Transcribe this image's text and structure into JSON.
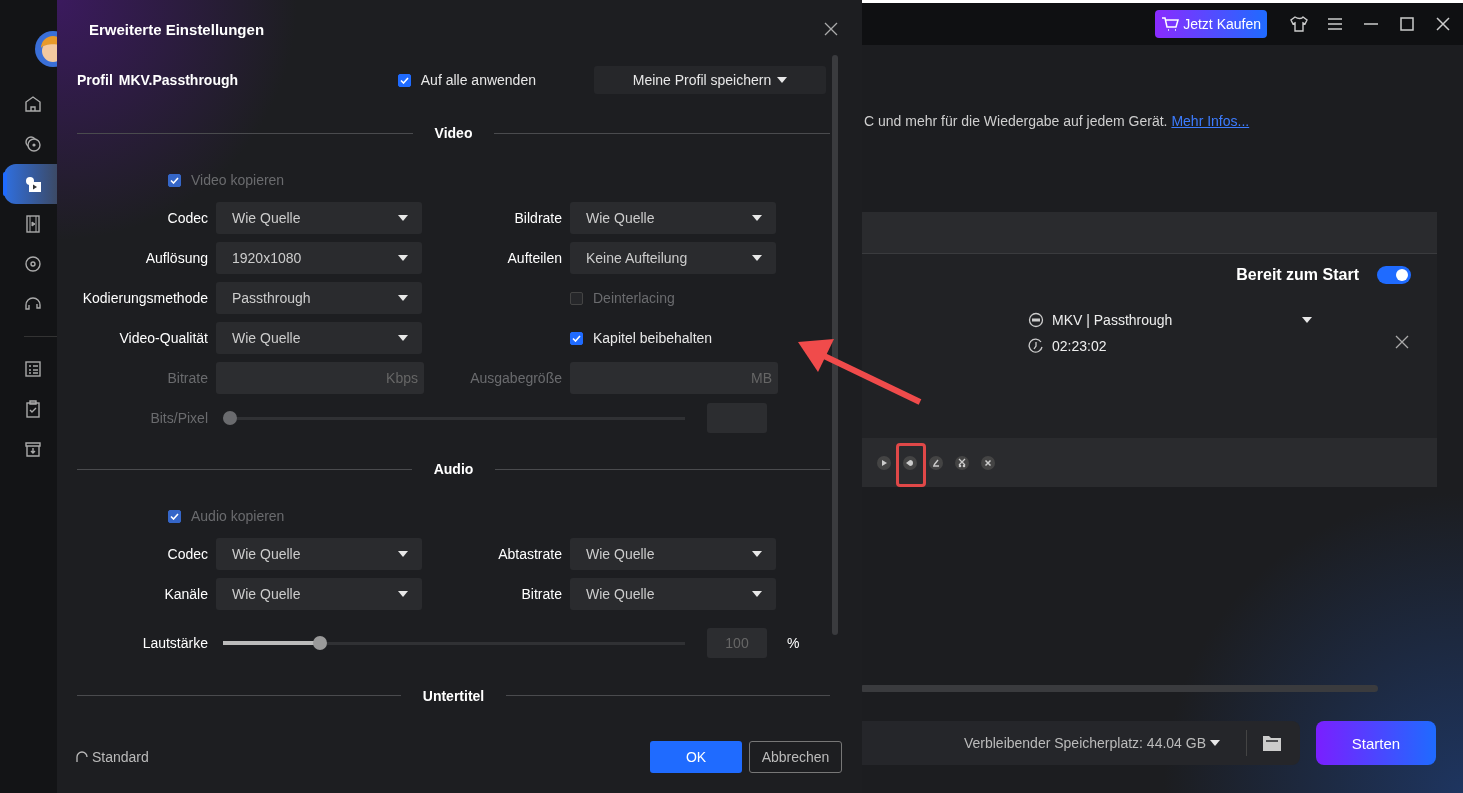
{
  "window": {
    "buy_button": "Jetzt Kaufen"
  },
  "sidebar": {
    "items": [
      {
        "selected": false
      },
      {
        "selected": false
      },
      {
        "selected": true
      },
      {
        "selected": false
      },
      {
        "selected": false
      },
      {
        "selected": false
      },
      {
        "selected": false
      },
      {
        "selected": false
      },
      {
        "selected": false
      }
    ]
  },
  "intro": {
    "text": "C und mehr für die Wiedergabe auf jedem Gerät.",
    "link": "Mehr Infos..."
  },
  "task": {
    "ready_label": "Bereit zum Start",
    "ready_on": true,
    "format": "MKV | Passthrough",
    "duration": "02:23:02"
  },
  "bottom_bar": {
    "storage": "Verbleibender Speicherplatz: 44.04 GB",
    "start_button": "Starten"
  },
  "dialog": {
    "title": "Erweiterte Einstellungen",
    "profile_label": "Profil",
    "profile_name": "MKV.Passthrough",
    "apply_all": {
      "label": "Auf alle anwenden",
      "checked": true
    },
    "save_profile": "Meine Profil speichern",
    "sections": [
      {
        "title": "Video",
        "rows": [
          {
            "kind": "copy",
            "label": "Video kopieren",
            "checked": true,
            "disabled": true
          },
          {
            "kind": "fields",
            "fields": [
              {
                "kind": "select",
                "label": "Codec",
                "value": "Wie Quelle"
              },
              {
                "kind": "select",
                "label": "Bildrate",
                "value": "Wie Quelle"
              }
            ]
          },
          {
            "kind": "fields",
            "fields": [
              {
                "kind": "select",
                "label": "Auflösung",
                "value": "1920x1080"
              },
              {
                "kind": "select",
                "label": "Aufteilen",
                "value": "Keine Aufteilung"
              }
            ]
          },
          {
            "kind": "fields",
            "fields": [
              {
                "kind": "select",
                "label": "Kodierungsmethode",
                "value": "Passthrough"
              },
              {
                "kind": "checkbox",
                "label": "Deinterlacing",
                "checked": false,
                "disabled": true
              }
            ]
          },
          {
            "kind": "fields",
            "fields": [
              {
                "kind": "select",
                "label": "Video-Qualität",
                "value": "Wie Quelle"
              },
              {
                "kind": "checkbox",
                "label": "Kapitel beibehalten",
                "checked": true,
                "disabled": false
              }
            ]
          },
          {
            "kind": "fields",
            "fields": [
              {
                "kind": "input",
                "label": "Bitrate",
                "unit": "Kbps",
                "disabled": true
              },
              {
                "kind": "input",
                "label": "Ausgabegröße",
                "unit": "MB",
                "disabled": true
              }
            ]
          },
          {
            "kind": "slider",
            "label": "Bits/Pixel",
            "level": 0,
            "disabled": true
          }
        ]
      },
      {
        "title": "Audio",
        "rows": [
          {
            "kind": "copy",
            "label": "Audio kopieren",
            "checked": true,
            "disabled": true
          },
          {
            "kind": "fields",
            "fields": [
              {
                "kind": "select",
                "label": "Codec",
                "value": "Wie Quelle"
              },
              {
                "kind": "select",
                "label": "Abtastrate",
                "value": "Wie Quelle"
              }
            ]
          },
          {
            "kind": "fields",
            "fields": [
              {
                "kind": "select",
                "label": "Kanäle",
                "value": "Wie Quelle"
              },
              {
                "kind": "select",
                "label": "Bitrate",
                "value": "Wie Quelle"
              }
            ]
          },
          {
            "kind": "slider",
            "label": "Lautstärke",
            "level": 0.21,
            "disabled": false,
            "value": "100",
            "unit": "%"
          }
        ]
      },
      {
        "title": "Untertitel"
      }
    ],
    "reset": "Standard",
    "ok_button": "OK",
    "cancel_button": "Abbrechen"
  }
}
